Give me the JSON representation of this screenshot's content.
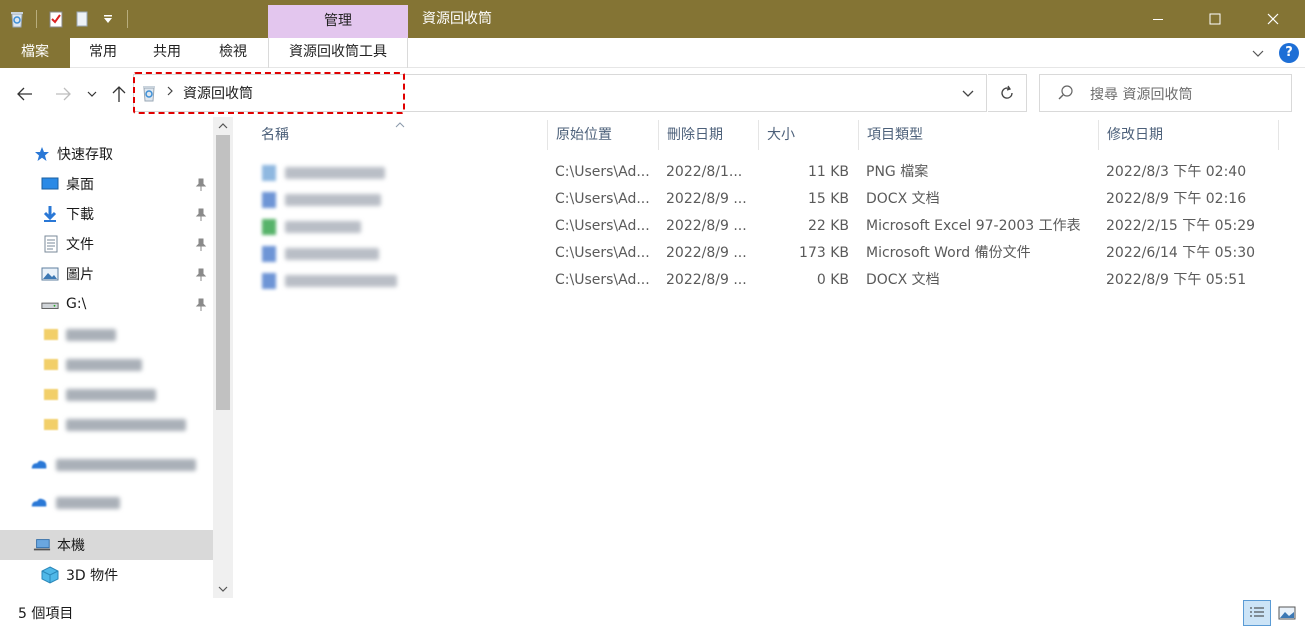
{
  "titlebar": {
    "manage_tab": "管理",
    "title": "資源回收筒",
    "bg_color": "#847434"
  },
  "ribbon": {
    "tabs": [
      {
        "label": "檔案",
        "type": "file"
      },
      {
        "label": "常用",
        "type": "normal"
      },
      {
        "label": "共用",
        "type": "normal"
      },
      {
        "label": "檢視",
        "type": "normal"
      },
      {
        "label": "資源回收筒工具",
        "type": "tool"
      }
    ],
    "help_label": "?"
  },
  "address": {
    "path": "資源回收筒",
    "icon": "recycle-bin-icon",
    "highlight_color": "#e00000"
  },
  "search": {
    "placeholder": "搜尋 資源回收筒"
  },
  "navpane": {
    "quick_access": "快速存取",
    "items": [
      {
        "label": "桌面",
        "icon": "desktop-icon",
        "pinned": true
      },
      {
        "label": "下載",
        "icon": "download-icon",
        "pinned": true
      },
      {
        "label": "文件",
        "icon": "documents-icon",
        "pinned": true
      },
      {
        "label": "圖片",
        "icon": "pictures-icon",
        "pinned": true
      },
      {
        "label": "G:\\",
        "icon": "drive-icon",
        "pinned": true
      }
    ],
    "this_pc": "本機",
    "objects_3d": "3D 物件"
  },
  "file_list": {
    "columns": [
      "名稱",
      "原始位置",
      "刪除日期",
      "大小",
      "項目類型",
      "修改日期"
    ],
    "rows": [
      {
        "location": "C:\\Users\\Ad...",
        "deleted": "2022/8/1...",
        "size": "11 KB",
        "type": "PNG 檔案",
        "modified": "2022/8/3 下午 02:40",
        "icon_color": "#8fb8e0"
      },
      {
        "location": "C:\\Users\\Ad...",
        "deleted": "2022/8/9 ...",
        "size": "15 KB",
        "type": "DOCX 文档",
        "modified": "2022/8/9 下午 02:16",
        "icon_color": "#6e95d6"
      },
      {
        "location": "C:\\Users\\Ad...",
        "deleted": "2022/8/9 ...",
        "size": "22 KB",
        "type": "Microsoft Excel 97-2003 工作表",
        "modified": "2022/2/15 下午 05:29",
        "icon_color": "#57b36a"
      },
      {
        "location": "C:\\Users\\Ad...",
        "deleted": "2022/8/9 ...",
        "size": "173 KB",
        "type": "Microsoft Word 備份文件",
        "modified": "2022/6/14 下午 05:30",
        "icon_color": "#6e95d6"
      },
      {
        "location": "C:\\Users\\Ad...",
        "deleted": "2022/8/9 ...",
        "size": "0 KB",
        "type": "DOCX 文档",
        "modified": "2022/8/9 下午 05:51",
        "icon_color": "#6e95d6"
      }
    ]
  },
  "status": {
    "item_count": "5 個項目"
  }
}
